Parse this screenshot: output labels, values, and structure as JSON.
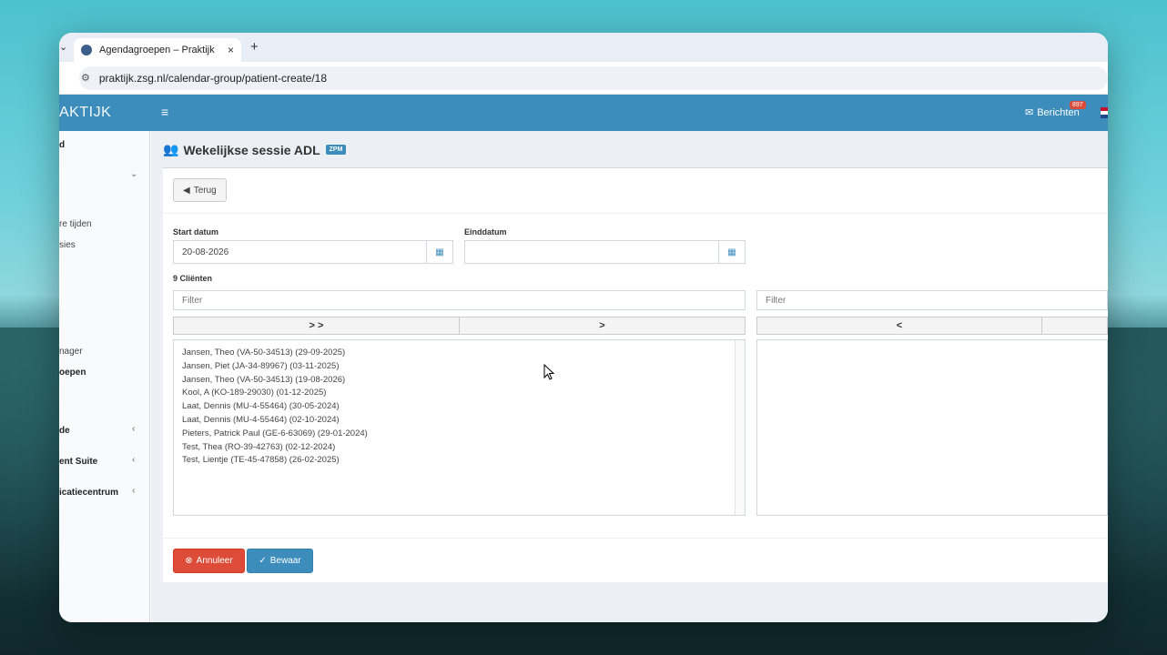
{
  "browser": {
    "tab_title": "Agendagroepen – Praktijk",
    "close_glyph": "×",
    "new_tab_glyph": "+",
    "url": "praktijk.zsg.nl/calendar-group/patient-create/18",
    "dropdown_glyph": "⌄"
  },
  "header": {
    "brand": "AKTIJK",
    "menu_glyph": "≡",
    "messages_label": "Berichten",
    "messages_count": "897"
  },
  "sidebar": {
    "items": [
      {
        "label": "d"
      },
      {
        "label": "re tijden"
      },
      {
        "label": "sies"
      },
      {
        "label": "nager"
      },
      {
        "label": "oepen"
      },
      {
        "label": "de"
      },
      {
        "label": "ent Suite"
      },
      {
        "label": "icatiecentrum"
      }
    ],
    "chevron_down": "⌄",
    "chevron_left": "‹"
  },
  "page": {
    "title": "Wekelijkse sessie ADL",
    "badge": "ZPM",
    "back_label": "Terug",
    "start_label": "Start datum",
    "start_value": "20-08-2026",
    "end_label": "Einddatum",
    "end_value": "",
    "clients_label": "9 Cliënten",
    "filter_placeholder": "Filter",
    "move_all_right": "> >",
    "move_right": ">",
    "move_left": "<",
    "clients": [
      "Jansen, Theo (VA-50-34513) (29-09-2025)",
      "Jansen, Piet (JA-34-89967) (03-11-2025)",
      "Jansen, Theo (VA-50-34513) (19-08-2026)",
      "Kool, A (KO-189-29030) (01-12-2025)",
      "Laat, Dennis (MU-4-55464) (30-05-2024)",
      "Laat, Dennis (MU-4-55464) (02-10-2024)",
      "Pieters, Patrick Paul (GE-6-63069) (29-01-2024)",
      "Test, Thea (RO-39-42763) (02-12-2024)",
      "Test, Lientje (TE-45-47858) (26-02-2025)"
    ],
    "cancel_label": "Annuleer",
    "save_label": "Bewaar"
  },
  "colors": {
    "header": "#3c8dbc",
    "danger": "#dd4b39",
    "primary": "#3c8dbc"
  },
  "icons": {
    "back": "arrow-circle-left-icon",
    "calendar": "calendar-icon",
    "cancel": "times-circle-icon",
    "save": "check-circle-icon",
    "users": "users-icon",
    "envelope": "envelope-icon"
  }
}
